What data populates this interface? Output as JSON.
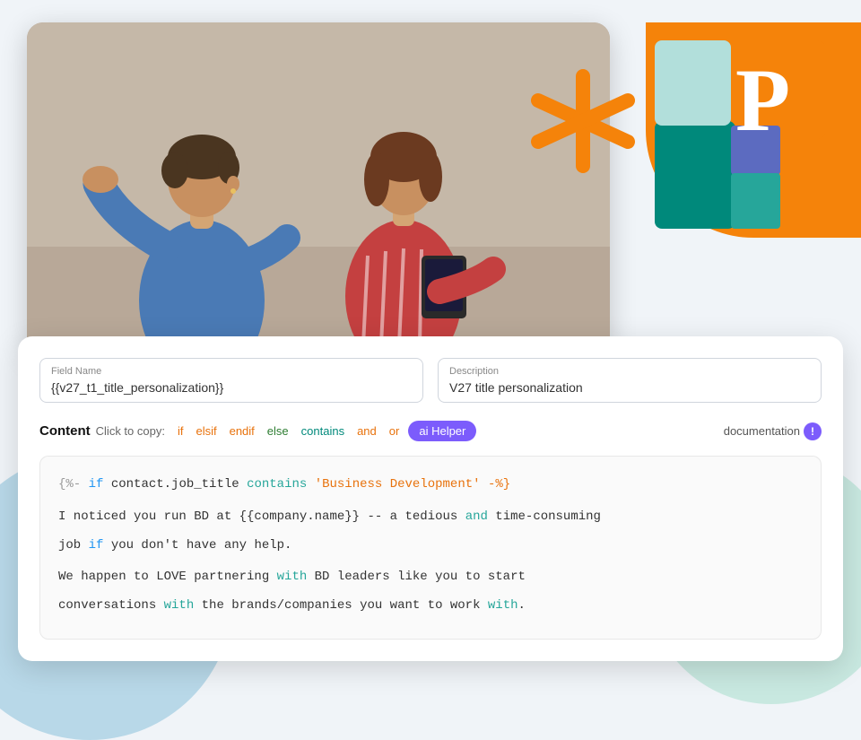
{
  "background": {
    "blue_circle": "decorative",
    "teal_circle": "decorative"
  },
  "image": {
    "alt": "Two people in conversation"
  },
  "brand": {
    "asterisk_color": "#f5830a",
    "logo_color": "#00897b"
  },
  "form": {
    "field_name_label": "Field Name",
    "field_name_value": "{{v27_t1_title_personalization}}",
    "description_label": "Description",
    "description_value": "V27 title personalization"
  },
  "content_bar": {
    "label": "Content",
    "click_to_copy": "Click to copy:",
    "tags": [
      "if",
      "elsif",
      "endif",
      "else",
      "contains",
      "and",
      "or"
    ],
    "ai_helper_label": "ai Helper",
    "documentation_label": "documentation"
  },
  "code": {
    "line1": "{%- if contact.job_title contains 'Business Development' -%}",
    "line2_part1": "I noticed you run BD at {{company.name}} -- a tedious",
    "line2_and": "and",
    "line2_part2": "time-consuming",
    "line3": "job if you don't have any help.",
    "line4": "",
    "line5_part1": "We happen to LOVE partnering",
    "line5_with1": "with",
    "line5_part2": "BD leaders like you to start",
    "line6_part1": "conversations",
    "line6_with2": "with",
    "line6_part2": "the brands/companies you want to work",
    "line6_with3": "with",
    "line6_end": "."
  }
}
